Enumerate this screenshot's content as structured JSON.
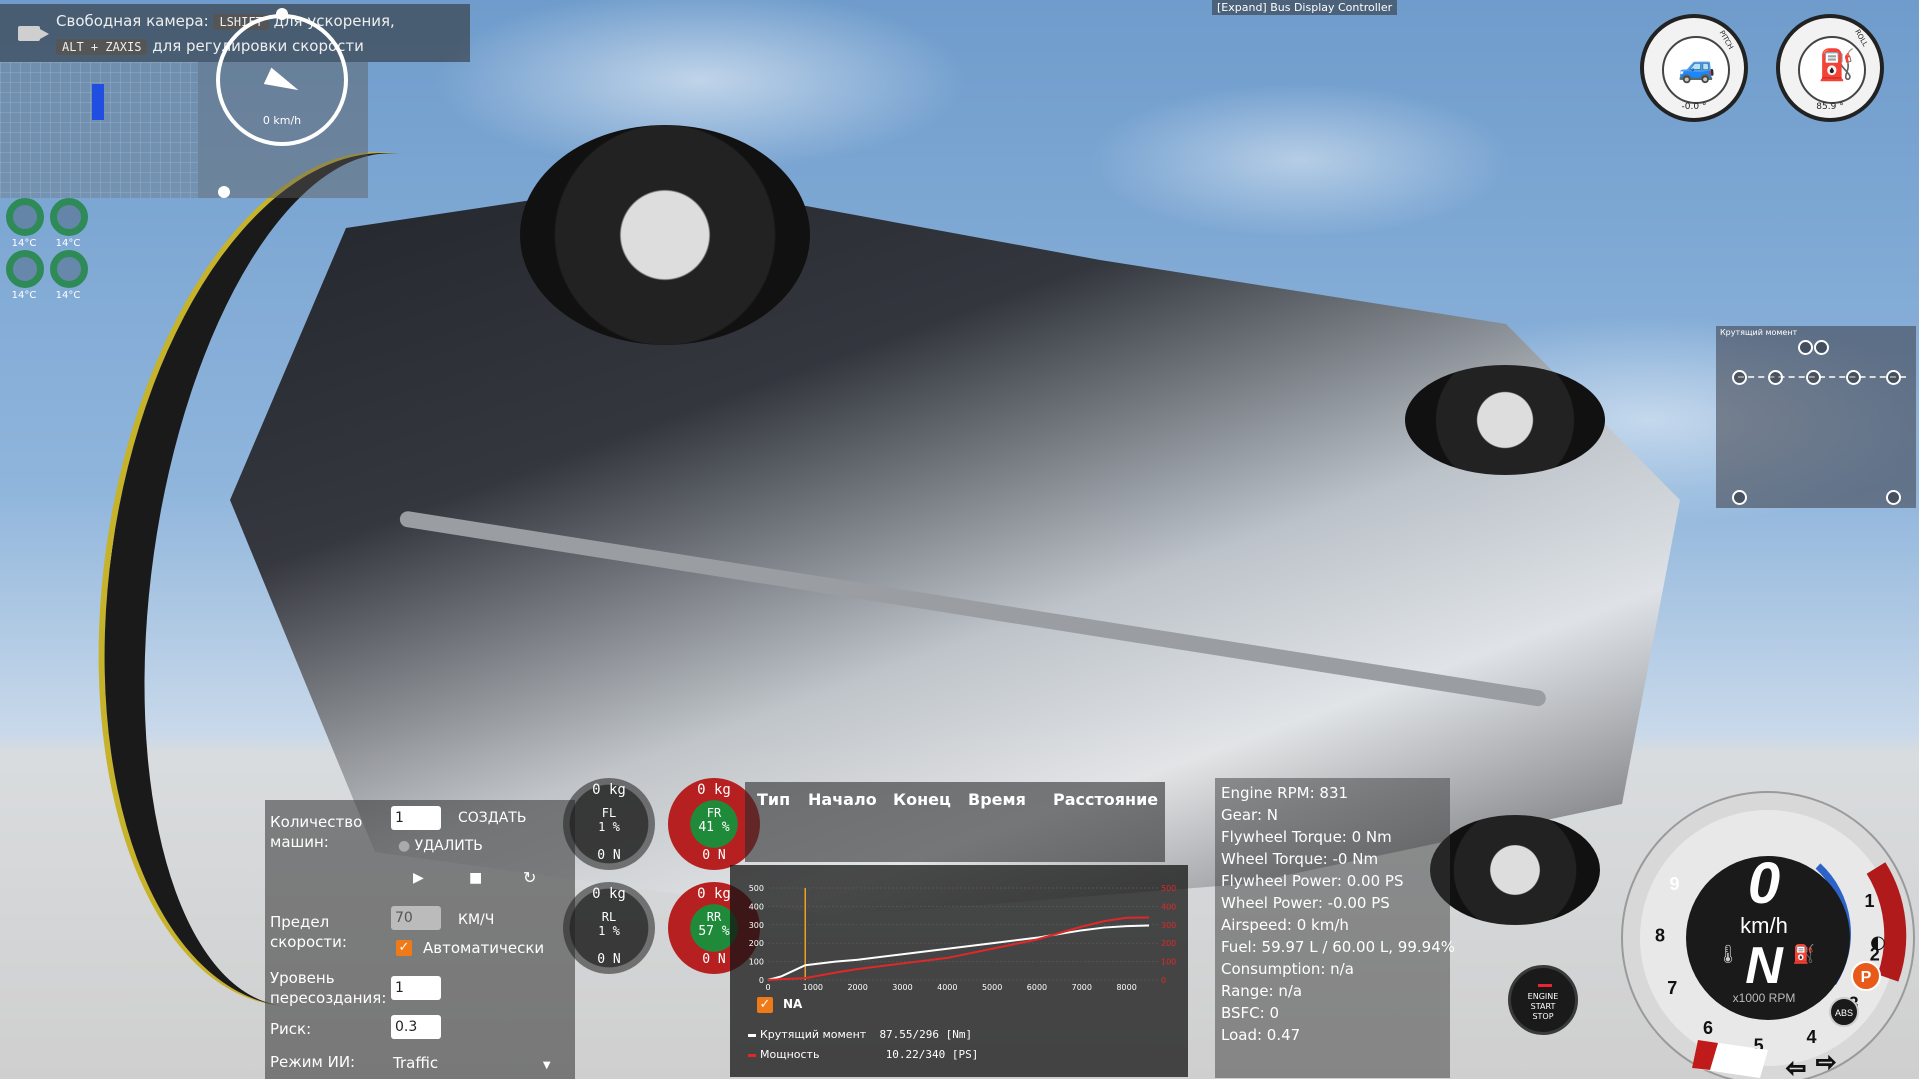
{
  "camera_hint": {
    "title": "Свободная камера:",
    "key1": "LSHIFT",
    "line1_suffix": "для ускорения,",
    "key2": "ALT + ZAXIS",
    "line2_suffix": "для регулировки скорости"
  },
  "mini_speed": {
    "text": "0 km/h"
  },
  "tires_temp": [
    "14°C",
    "14°C",
    "14°C",
    "14°C"
  ],
  "bus_controller": "[Expand] Bus Display Controller",
  "inclinometer": {
    "pitch_label": "PITCH",
    "pitch_value": "-0.0 °",
    "roll_label": "ROLL",
    "roll_value": "85.9 °"
  },
  "torque_widget": {
    "title": "Крутящий момент"
  },
  "ai_panel": {
    "count_label": "Количество машин:",
    "count_value": "1",
    "create": "СОЗДАТЬ",
    "remove": "УДАЛИТЬ",
    "speed_limit_label": "Предел скорости:",
    "speed_limit_value": "70",
    "speed_unit": "КМ/Ч",
    "auto_label": "Автоматически",
    "respawn_label": "Уровень пересоздания:",
    "respawn_value": "1",
    "risk_label": "Риск:",
    "risk_value": "0.3",
    "mode_label": "Режим ИИ:",
    "mode_value": "Traffic"
  },
  "tire_loads": {
    "fl": {
      "kg": "0 kg",
      "name": "FL",
      "pct": "1 %",
      "n": "0 N",
      "style": "gray"
    },
    "fr": {
      "kg": "0 kg",
      "name": "FR",
      "pct": "41 %",
      "n": "0 N",
      "style": "red"
    },
    "rl": {
      "kg": "0 kg",
      "name": "RL",
      "pct": "1 %",
      "n": "0 N",
      "style": "gray"
    },
    "rr": {
      "kg": "0 kg",
      "name": "RR",
      "pct": "57 %",
      "n": "0 N",
      "style": "red"
    }
  },
  "timing_headers": [
    "Тип",
    "Начало",
    "Конец",
    "Время",
    "Расстояние"
  ],
  "chart_data": {
    "type": "line",
    "x_ticks": [
      0,
      1000,
      2000,
      3000,
      4000,
      5000,
      6000,
      7000,
      8000
    ],
    "y_ticks_left": [
      0,
      100,
      200,
      300,
      400,
      500
    ],
    "y_ticks_right": [
      0,
      100,
      200,
      300,
      400,
      500
    ],
    "xlim": [
      0,
      8700
    ],
    "ylim": [
      0,
      500
    ],
    "current_rpm": 831,
    "series": [
      {
        "name": "Крутящий момент",
        "color": "#ffffff",
        "x": [
          0,
          300,
          831,
          1500,
          2000,
          3000,
          4000,
          5000,
          6000,
          7000,
          7500,
          8000,
          8500
        ],
        "y": [
          0,
          20,
          80,
          100,
          110,
          140,
          170,
          200,
          230,
          270,
          285,
          293,
          296
        ]
      },
      {
        "name": "Мощность",
        "color": "#e02828",
        "x": [
          0,
          300,
          831,
          1500,
          2000,
          3000,
          4000,
          5000,
          6000,
          7000,
          7500,
          8000,
          8500
        ],
        "y": [
          0,
          5,
          10,
          40,
          60,
          90,
          120,
          170,
          220,
          290,
          320,
          338,
          340
        ]
      }
    ],
    "na_label": "NA",
    "legend": [
      {
        "label": "Крутящий момент",
        "value": "87.55/296 [Nm]"
      },
      {
        "label": "Мощность",
        "value": "10.22/340 [PS]"
      }
    ]
  },
  "stats": {
    "rpm": "Engine RPM: 831",
    "gear": "Gear: N",
    "flywheel_torque": "Flywheel Torque: 0 Nm",
    "wheel_torque": "Wheel Torque: -0 Nm",
    "flywheel_power": "Flywheel Power: 0.00 PS",
    "wheel_power": "Wheel Power: -0.00 PS",
    "airspeed": "Airspeed: 0 km/h",
    "fuel": "Fuel: 59.97 L / 60.00 L, 99.94%",
    "consumption": "Consumption: n/a",
    "range": "Range: n/a",
    "bsfc": "BSFC: 0",
    "load": "Load: 0.47"
  },
  "engine_button": {
    "line1": "ENGINE",
    "line2": "START",
    "line3": "STOP"
  },
  "gauge": {
    "speed": "0",
    "unit": "km/h",
    "gear": "N",
    "rpm_label": "x1000 RPM",
    "ticks": [
      "1",
      "2",
      "3",
      "4",
      "5",
      "6",
      "7",
      "8",
      "9"
    ],
    "parking": "P",
    "abs": "ABS",
    "colors": {
      "redline": "#b01a1a",
      "blue": "#2d63c8",
      "red": "#d42020"
    }
  }
}
